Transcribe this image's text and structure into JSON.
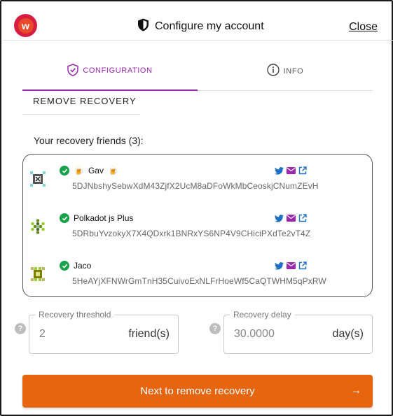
{
  "header": {
    "title": "Configure my account",
    "close_label": "Close",
    "logo_letter": "w"
  },
  "tabs": [
    {
      "label": "CONFIGURATION",
      "icon": "shield-check-icon",
      "active": true
    },
    {
      "label": "INFO",
      "icon": "info-circle-icon",
      "active": false
    }
  ],
  "section_heading": "REMOVE RECOVERY",
  "friends": {
    "title": "Your recovery friends (3):",
    "items": [
      {
        "name": "Gav",
        "address": "5DJNbshySebwXdM43ZjfX2UcM8aDFoWkMbCeoskjCNumZEvH",
        "verified": true,
        "emoji": "🍺"
      },
      {
        "name": "Polkadot js Plus",
        "address": "5DRbuYvzokyX7X4QDxrk1BNRxYS6NP4V9CHiciPXdTe2vT4Z",
        "verified": true
      },
      {
        "name": "Jaco",
        "address": "5HeAYjXFNWrGmTnH35CuivoExNLFrHoeWf5CaQTWHM5qPxRW",
        "verified": true
      }
    ]
  },
  "threshold": {
    "legend": "Recovery threshold",
    "value": "2",
    "unit": "friend(s)"
  },
  "delay": {
    "legend": "Recovery delay",
    "value": "30.0000",
    "unit": "day(s)"
  },
  "next_button": {
    "label": "Next to remove recovery",
    "arrow": "→"
  },
  "colors": {
    "accent": "#9b26af",
    "button": "#e8650f",
    "check": "#18a34a"
  }
}
